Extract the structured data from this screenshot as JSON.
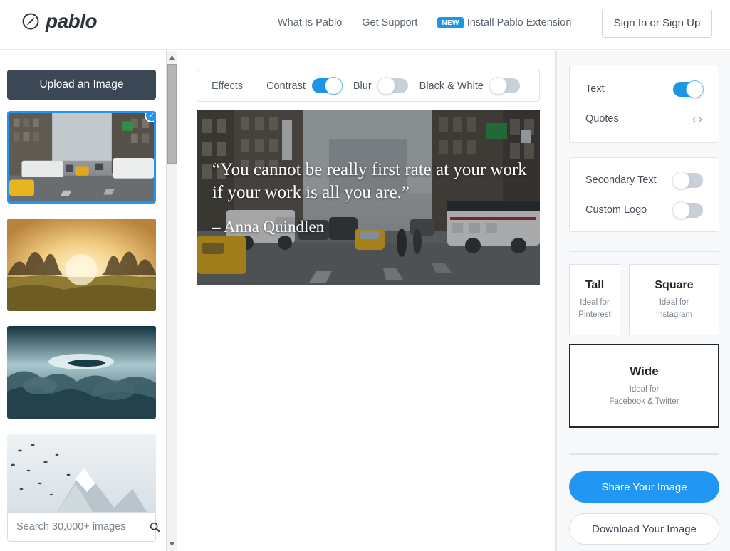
{
  "header": {
    "logo_text": "pablo",
    "logo_icon": "pablo-circle-slash-icon",
    "nav": [
      {
        "label": "What Is Pablo"
      },
      {
        "label": "Get Support"
      }
    ],
    "extension": {
      "badge": "NEW",
      "label": "Install Pablo Extension"
    },
    "signin_label": "Sign In or Sign Up"
  },
  "sidebar": {
    "upload_label": "Upload an Image",
    "search_placeholder": "Search 30,000+ images",
    "search_value": "",
    "search_icon": "search-icon",
    "thumbnails": [
      {
        "name": "city-street-taxis",
        "selected": true,
        "check_icon": "check-icon"
      },
      {
        "name": "sunset-through-trees-grass",
        "selected": false
      },
      {
        "name": "clouds-from-above",
        "selected": false
      },
      {
        "name": "snowy-mountain-with-birds",
        "selected": false
      }
    ],
    "scrollbar": {
      "up_icon": "caret-up-icon",
      "down_icon": "caret-down-icon"
    }
  },
  "effects": {
    "label": "Effects",
    "items": [
      {
        "label": "Contrast",
        "on": true
      },
      {
        "label": "Blur",
        "on": false
      },
      {
        "label": "Black & White",
        "on": false
      }
    ]
  },
  "preview": {
    "image_name": "city-street-taxis",
    "quote": "“You cannot be really first rate at your work if your work is all you are.”",
    "author": "– Anna Quindlen"
  },
  "panel": {
    "text_row": {
      "label": "Text",
      "on": true
    },
    "quotes_row": {
      "label": "Quotes",
      "prev_icon": "chevron-left-icon",
      "next_icon": "chevron-right-icon",
      "prev": "‹",
      "next": "›"
    },
    "secondary_text": {
      "label": "Secondary Text",
      "on": false
    },
    "custom_logo": {
      "label": "Custom Logo",
      "on": false
    },
    "sizes": [
      {
        "title": "Tall",
        "sub1": "Ideal for",
        "sub2": "Pinterest",
        "active": false
      },
      {
        "title": "Square",
        "sub1": "Ideal for",
        "sub2": "Instagram",
        "active": false
      },
      {
        "title": "Wide",
        "sub1": "Ideal for",
        "sub2": "Facebook & Twitter",
        "active": true
      }
    ],
    "share_label": "Share Your Image",
    "download_label": "Download Your Image"
  },
  "colors": {
    "accent_blue": "#2196f3",
    "toggle_on": "#1e96e8",
    "toggle_off": "#c9d0d8",
    "dark_button": "#3c4755",
    "panel_bg": "#f7f8f9"
  }
}
